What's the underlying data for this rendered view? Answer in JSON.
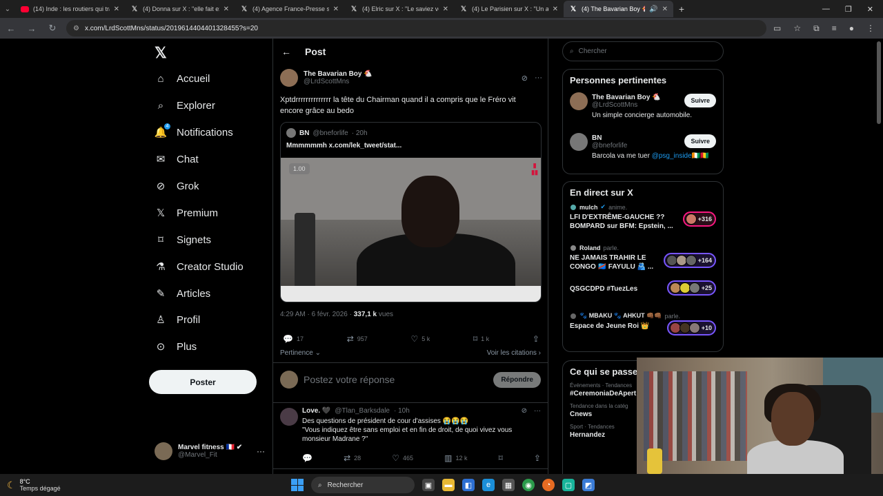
{
  "browser": {
    "tabs": [
      {
        "icon": "youtube",
        "title": "(14) Inde : les routiers qui trans",
        "active": false
      },
      {
        "icon": "x",
        "title": "(4) Donna sur X : \"elle fait expr",
        "active": false
      },
      {
        "icon": "x",
        "title": "(4) Agence France-Presse sur X",
        "active": false
      },
      {
        "icon": "x",
        "title": "(4) Elric sur X : \"Le saviez vous?",
        "active": false
      },
      {
        "icon": "x",
        "title": "(4) Le Parisien sur X : \"Un agent",
        "active": false
      },
      {
        "icon": "x",
        "title": "(4) The Bavarian Boy 🐔 sur",
        "active": true
      }
    ],
    "url": "x.com/LrdScottMns/status/2019614404401328455?s=20"
  },
  "nav": {
    "logo": "𝕏",
    "items": [
      {
        "label": "Accueil",
        "icon": "home-icon",
        "glyph": "⌂"
      },
      {
        "label": "Explorer",
        "icon": "search-icon",
        "glyph": "⌕"
      },
      {
        "label": "Notifications",
        "icon": "bell-icon",
        "glyph": "🔔"
      },
      {
        "label": "Chat",
        "icon": "mail-icon",
        "glyph": "✉"
      },
      {
        "label": "Grok",
        "icon": "grok-icon",
        "glyph": "⊘"
      },
      {
        "label": "Premium",
        "icon": "x-premium-icon",
        "glyph": "𝕏"
      },
      {
        "label": "Signets",
        "icon": "bookmark-icon",
        "glyph": "🔖"
      },
      {
        "label": "Creator Studio",
        "icon": "flask-icon",
        "glyph": "⚗"
      },
      {
        "label": "Articles",
        "icon": "article-icon",
        "glyph": "📝"
      },
      {
        "label": "Profil",
        "icon": "profile-icon",
        "glyph": "👤"
      },
      {
        "label": "Plus",
        "icon": "more-circle-icon",
        "glyph": "⊙"
      }
    ],
    "notif_count": "4",
    "post_button": "Poster",
    "account": {
      "name": "Marvel fitness 🇫🇷 ✔",
      "handle": "@Marvel_Fit"
    }
  },
  "main": {
    "header_title": "Post",
    "post": {
      "author_name": "The Bavarian Boy 🐔",
      "author_handle": "@LrdScottMns",
      "text": "Xptdrrrrrrrrrrrrrr la tête du Chairman quand il a compris que le Fréro vit encore grâce au bedo",
      "quote": {
        "name": "BN",
        "handle": "@bneforlife",
        "time": "· 20h",
        "text": "Mmmmmmh  x.com/lek_tweet/stat...",
        "speed": "1.00"
      },
      "time": "4:29 AM · 6 févr. 2026 · ",
      "views_count": "337,1 k",
      "views_label": " vues",
      "replies": "17",
      "reposts": "957",
      "likes": "5 k",
      "bookmarks": "1 k",
      "sort_label": "Pertinence ⌄",
      "quotes_link": "Voir les citations ›"
    },
    "reply_box": {
      "placeholder": "Postez votre réponse",
      "button": "Répondre"
    },
    "reply": {
      "name": "Love. 🖤",
      "handle": "@Tlan_Barksdale",
      "time": "· 10h",
      "text_line1": "Des questions de président de cour d'assises 😭😭😭",
      "text_line2": "\"Vous indiquez être sans emploi et en fin de droit, de quoi vivez vous monsieur Madrane ?\"",
      "reposts": "28",
      "likes": "465",
      "views": "12 k"
    }
  },
  "sidebar": {
    "search_placeholder": "Chercher",
    "relevant_title": "Personnes pertinentes",
    "people": [
      {
        "name": "The Bavarian Boy 🐔",
        "handle": "@LrdScottMns",
        "bio": "Un simple concierge automobile.",
        "button": "Suivre"
      },
      {
        "name": "BN",
        "handle": "@bneforlife",
        "bio_prefix": "Barcola va me tuer ",
        "bio_mention": "@psg_inside",
        "bio_suffix": "🇨🇮🇬🇳",
        "button": "Suivre"
      }
    ],
    "live_title": "En direct sur X",
    "live": [
      {
        "host": "mulch",
        "verified": true,
        "status": "anime.",
        "title": "LFI D'EXTRÊME-GAUCHE ?? BOMPARD sur BFM: Epstein, ...",
        "count": "+316",
        "color": "#f91880"
      },
      {
        "host": "Roland",
        "verified": false,
        "status": "parle.",
        "title": "NE JAMAIS TRAHIR LE CONGO 🇨🇩 FAYULU 🫂 ...",
        "count": "+164",
        "color": "#7856ff"
      },
      {
        "host": "",
        "verified": false,
        "status": "",
        "title": "QSGCDPD #TuezLes",
        "count": "+25",
        "color": "#7856ff"
      },
      {
        "host": "🐾 MBAKU 🐾 AHKUT 👊🏾👊🏾",
        "verified": false,
        "status": "parle.",
        "title": "Espace de Jeune Roi 👑",
        "count": "+10",
        "color": "#7856ff"
      }
    ],
    "happening_title": "Ce qui se passe",
    "trends": [
      {
        "context": "Événements · Tendances",
        "name": "#CeremoniaDeApert"
      },
      {
        "context": "Tendance dans la catég",
        "name": "Cnews"
      },
      {
        "context": "Sport · Tendances",
        "name": "Hernandez"
      }
    ]
  },
  "taskbar": {
    "temp": "8°C",
    "weather": "Temps dégagé",
    "search": "Rechercher"
  }
}
